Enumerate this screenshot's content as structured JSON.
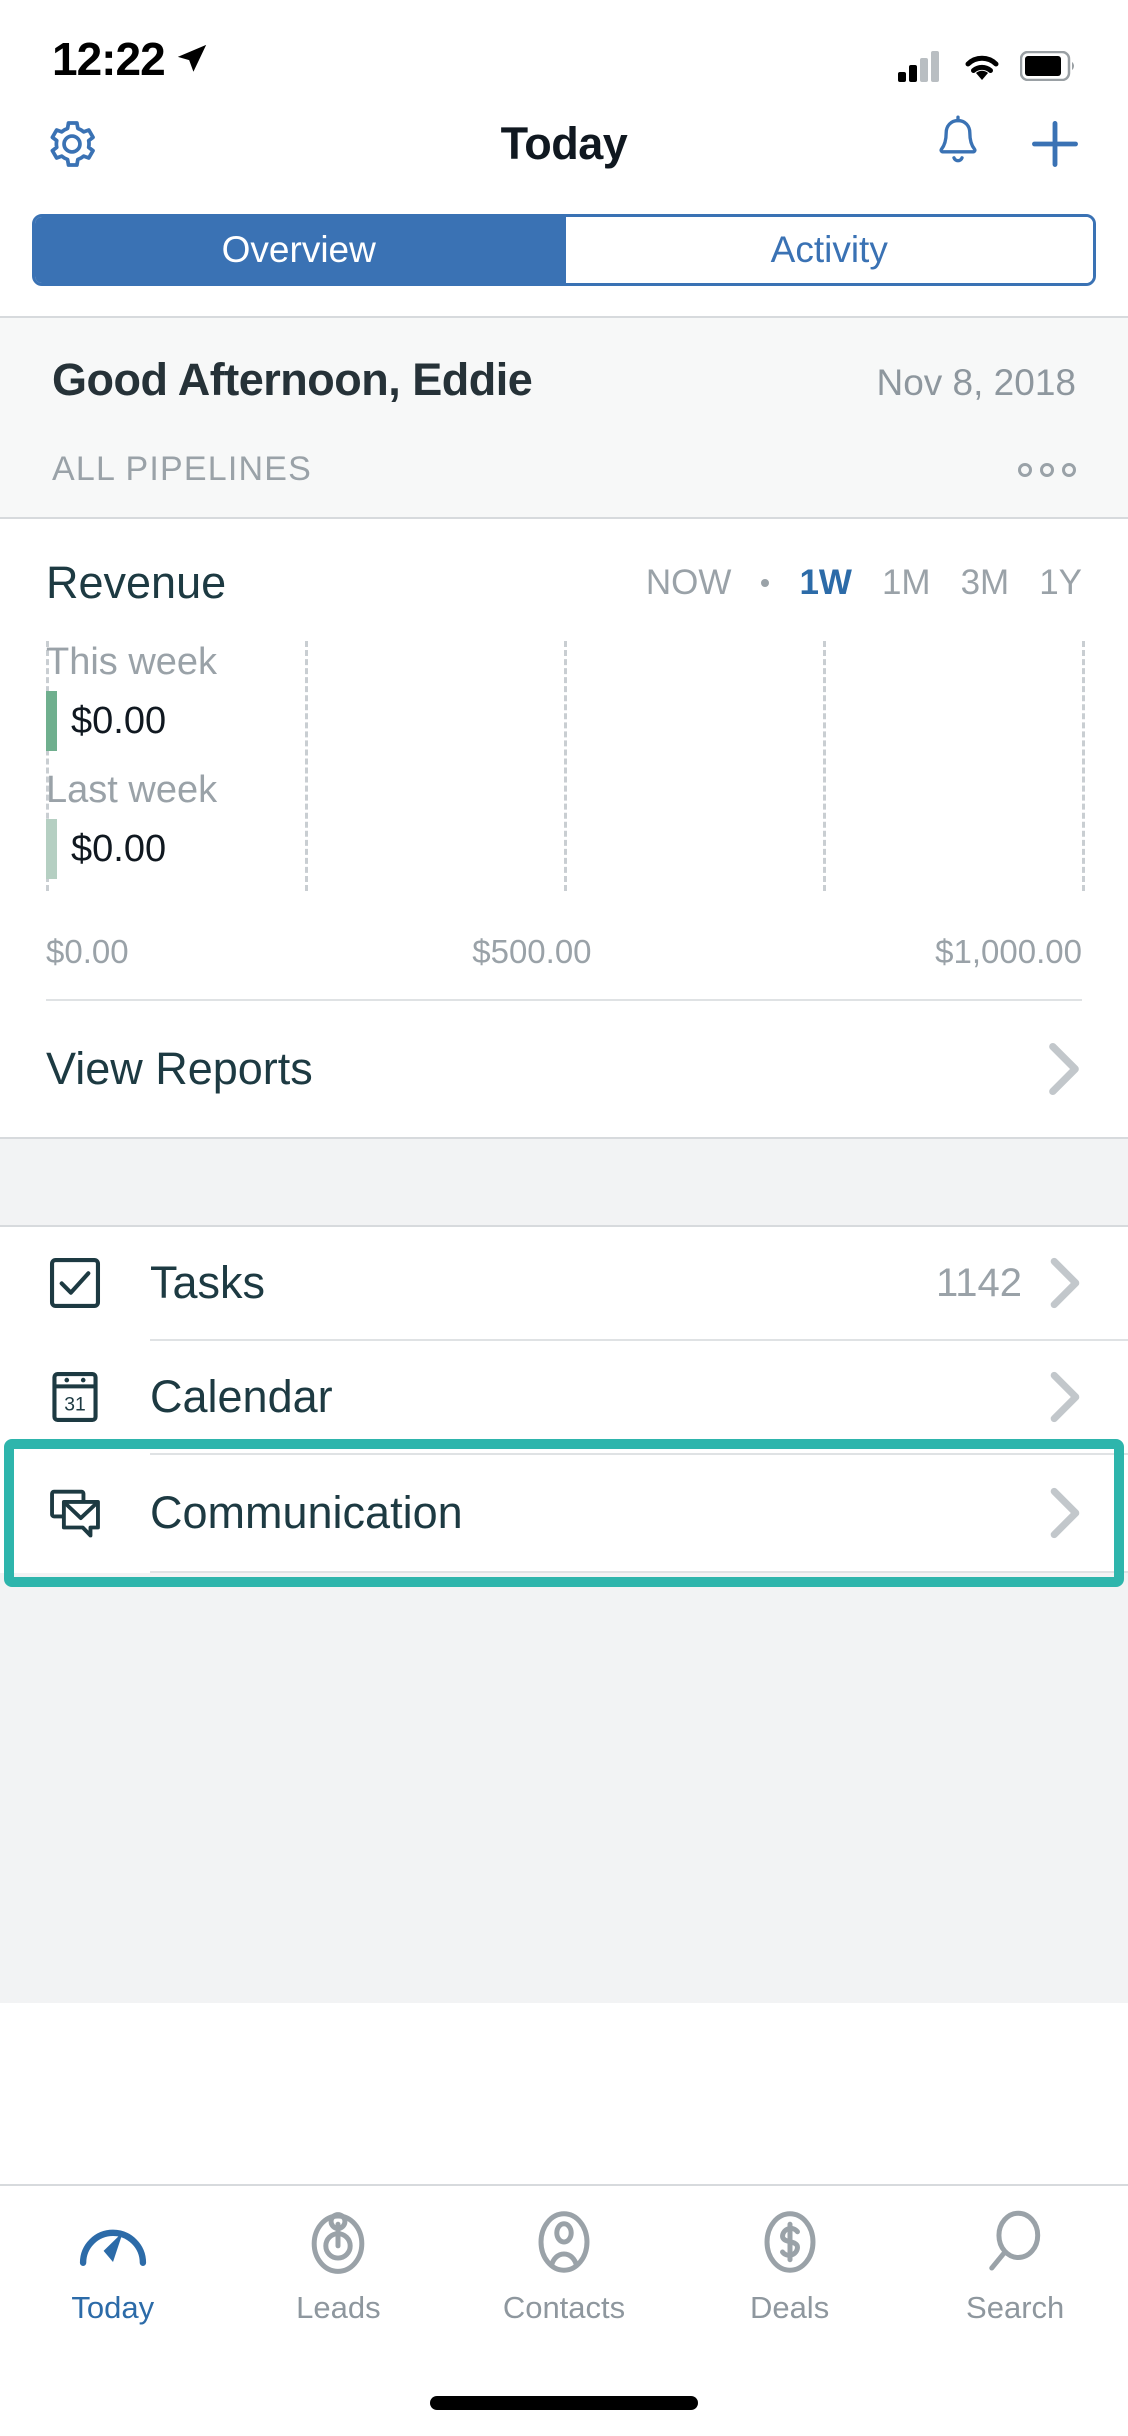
{
  "status_bar": {
    "time": "12:22",
    "location_icon": "location-arrow-icon",
    "signal_icon": "cellular-signal-icon",
    "wifi_icon": "wifi-icon",
    "battery_icon": "battery-icon"
  },
  "nav": {
    "settings_icon": "gear-icon",
    "title": "Today",
    "notifications_icon": "bell-icon",
    "add_icon": "plus-icon"
  },
  "segment": {
    "overview_label": "Overview",
    "activity_label": "Activity",
    "selected": "Overview",
    "accent_color": "#3A72B4"
  },
  "greeting": {
    "title": "Good Afternoon, Eddie",
    "date": "Nov 8, 2018",
    "pipeline_label": "ALL PIPELINES",
    "more_icon": "ellipsis-icon"
  },
  "revenue": {
    "title": "Revenue",
    "ranges": [
      {
        "label": "NOW",
        "active": false
      },
      {
        "label": "1W",
        "active": true
      },
      {
        "label": "1M",
        "active": false
      },
      {
        "label": "3M",
        "active": false
      },
      {
        "label": "1Y",
        "active": false
      }
    ],
    "view_reports_label": "View Reports",
    "chevron_icon": "chevron-right-icon"
  },
  "chart_data": {
    "type": "bar",
    "orientation": "horizontal",
    "title": "Revenue",
    "categories": [
      "This week",
      "Last week"
    ],
    "values": [
      0,
      0
    ],
    "value_labels": [
      "$0.00",
      "$0.00"
    ],
    "series": [
      {
        "name": "This week",
        "values": [
          0
        ],
        "color": "#6FAF8E"
      },
      {
        "name": "Last week",
        "values": [
          0
        ],
        "color": "#B5CFC2"
      }
    ],
    "xlabel": "",
    "ylabel": "",
    "xlim": [
      0,
      1000
    ],
    "x_ticks": [
      0,
      500,
      1000
    ],
    "x_tick_labels": [
      "$0.00",
      "$500.00",
      "$1,000.00"
    ],
    "gridlines": [
      0,
      250,
      500,
      750,
      1000
    ],
    "grid": true,
    "grid_style": "dashed",
    "legend": "none",
    "range_selected": "1W"
  },
  "list": {
    "items": [
      {
        "label": "Tasks",
        "count": "1142",
        "icon": "checkbox-check-icon",
        "highlighted": false
      },
      {
        "label": "Calendar",
        "count": "",
        "icon": "calendar-31-icon",
        "highlighted": false
      },
      {
        "label": "Communication",
        "count": "",
        "icon": "message-envelope-icon",
        "highlighted": true
      }
    ],
    "chevron_icon": "chevron-right-icon",
    "highlight_color": "#2EB5AC"
  },
  "tabbar": {
    "items": [
      {
        "label": "Today",
        "icon": "gauge-icon",
        "active": true
      },
      {
        "label": "Leads",
        "icon": "lead-target-icon",
        "active": false
      },
      {
        "label": "Contacts",
        "icon": "contact-person-icon",
        "active": false
      },
      {
        "label": "Deals",
        "icon": "dollar-circle-icon",
        "active": false
      },
      {
        "label": "Search",
        "icon": "search-icon",
        "active": false
      }
    ],
    "active_color": "#2C6BA8",
    "inactive_color": "#8e979e"
  }
}
